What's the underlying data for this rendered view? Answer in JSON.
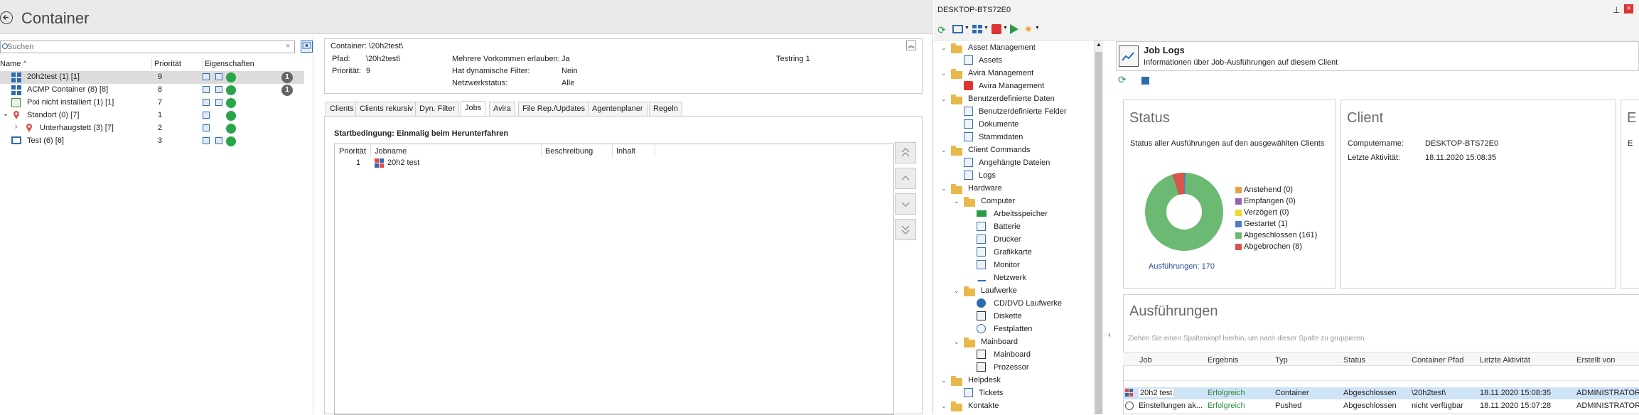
{
  "left": {
    "title": "Container",
    "search_placeholder": "Suchen",
    "columns": {
      "name": "Name",
      "priority": "Priorität",
      "props": "Eigenschaften"
    },
    "tree": [
      {
        "label": "20h2test (1) [1]",
        "priority": "9",
        "badge": "1"
      },
      {
        "label": "ACMP Container (8) [8]",
        "priority": "8",
        "badge": "1"
      },
      {
        "label": "Pixi nicht installiert (1) [1]",
        "priority": "7"
      },
      {
        "label": "Standort (0) [7]",
        "priority": "1"
      },
      {
        "label": "Unterhaugstett (3) [7]",
        "priority": "2"
      },
      {
        "label": "Test (6) [6]",
        "priority": "3"
      }
    ],
    "details": {
      "container_label": "Container: \\20h2test\\",
      "path_label": "Pfad:",
      "path_value": "\\20h2test\\",
      "prio_label": "Priorität:",
      "prio_value": "9",
      "multi_label": "Mehrere Vorkommen erlauben:",
      "multi_value": "Ja",
      "filter_label": "Hat dynamische Filter:",
      "filter_value": "Nein",
      "net_label": "Netzwerkstatus:",
      "net_value": "Alle",
      "testring": "Testring 1"
    },
    "tabs": [
      "Clients",
      "Clients rekursiv",
      "Dyn. Filter",
      "Jobs",
      "Avira",
      "File Rep./Updates",
      "Agentenplaner",
      "Regeln"
    ],
    "active_tab": "Jobs",
    "job_panel": {
      "start_condition": "Startbedingung: Einmalig beim Herunterfahren",
      "columns": [
        "Priorität",
        "Jobname",
        "Beschreibung",
        "Inhalt"
      ],
      "rows": [
        {
          "priority": "1",
          "name": "20h2 test"
        }
      ]
    }
  },
  "right": {
    "title": "DESKTOP-BTS72E0",
    "tree": {
      "asset_mgmt": "Asset Management",
      "assets": "Assets",
      "avira_mgmt": "Avira Management",
      "avira_mgmt_item": "Avira Management",
      "custom_data": "Benutzerdefinierte Daten",
      "custom_fields": "Benutzerdefinierte Felder",
      "documents": "Dokumente",
      "master_data": "Stammdaten",
      "client_commands": "Client Commands",
      "attached_files": "Angehängte Dateien",
      "logs": "Logs",
      "hardware": "Hardware",
      "computer": "Computer",
      "memory": "Arbeitsspeicher",
      "battery": "Batterie",
      "printer": "Drucker",
      "graphics": "Grafikkarte",
      "monitor": "Monitor",
      "network": "Netzwerk",
      "drives": "Laufwerke",
      "cd_drives": "CD/DVD Laufwerke",
      "floppy": "Diskette",
      "hdd": "Festplatten",
      "mainboard_grp": "Mainboard",
      "mainboard": "Mainboard",
      "processor": "Prozessor",
      "helpdesk": "Helpdesk",
      "tickets": "Tickets",
      "contacts": "Kontakte"
    },
    "header": {
      "title": "Job Logs",
      "subtitle": "Informationen über Job-Ausführungen auf diesem Client"
    },
    "status_card": {
      "title": "Status",
      "subtitle": "Status aller Ausführungen auf den ausgewählten Clients",
      "executions": "Ausführungen: 170",
      "legend": [
        {
          "label": "Anstehend (0)",
          "color": "#e8a046"
        },
        {
          "label": "Empfangen (0)",
          "color": "#9b5fb0"
        },
        {
          "label": "Verzögert (0)",
          "color": "#f2d72b"
        },
        {
          "label": "Gestartet (1)",
          "color": "#4a7cc8"
        },
        {
          "label": "Abgeschlossen (161)",
          "color": "#6cb974"
        },
        {
          "label": "Abgebrochen (8)",
          "color": "#d9534f"
        }
      ]
    },
    "client_card": {
      "title": "Client",
      "name_label": "Computername:",
      "name_value": "DESKTOP-BTS72E0",
      "activity_label": "Letzte Aktivität:",
      "activity_value": "18.11.2020 15:08:35"
    },
    "third_card_letter": "E",
    "third_card_sub": "E",
    "executions_grid": {
      "title": "Ausführungen",
      "group_hint": "Ziehen Sie einen Spaltenkopf hierhin, um nach dieser Spalte zu gruppieren",
      "columns": [
        "Job",
        "Ergebnis",
        "Typ",
        "Status",
        "Container Pfad",
        "Letzte Aktivität",
        "Erstellt von"
      ],
      "rows": [
        [
          "20h2 test",
          "Erfolgreich",
          "Container",
          "Abgeschlossen",
          "\\20h2test\\",
          "18.11.2020 15:08:35",
          "ADMINISTRATOR"
        ],
        [
          "Einstellungen ak...",
          "Erfolgreich",
          "Pushed",
          "Abgeschlossen",
          "nicht verfügbar",
          "18.11.2020 15:07:28",
          "ADMINISTRATOR"
        ]
      ]
    }
  }
}
